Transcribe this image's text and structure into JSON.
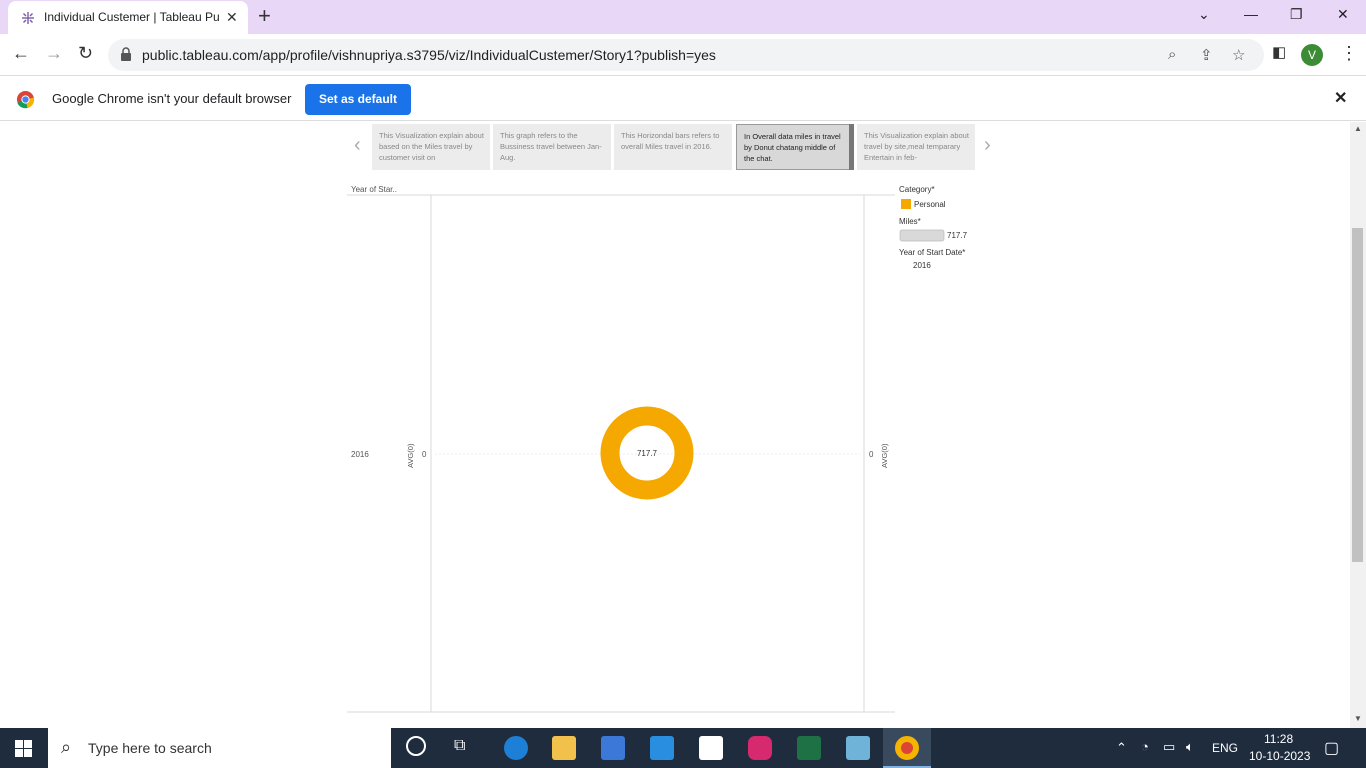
{
  "browser": {
    "tab_title": "Individual Custemer | Tableau Pu",
    "url": "public.tableau.com/app/profile/vishnupriya.s3795/viz/IndividualCustemer/Story1?publish=yes",
    "avatar_letter": "V"
  },
  "infobar": {
    "message": "Google Chrome isn't your default browser",
    "button_label": "Set as default"
  },
  "story": {
    "points": [
      {
        "text": "This Visualization explain about based on the Miles travel by customer visit  on"
      },
      {
        "text": "This graph refers to the Bussiness travel between Jan-Aug."
      },
      {
        "text": "This Horizondal bars refers to overall Miles travel in 2016."
      },
      {
        "text": "In Overall data miles in travel by Donut chatang middle of the chat."
      },
      {
        "text": "This Visualization explain about  travel by site,meal temparary Entertain in  feb-"
      }
    ]
  },
  "chart_data": {
    "type": "pie",
    "row_header": "Year of Star..",
    "row_label": "2016",
    "axis_label": "AVG(0)",
    "axis_tick_left": "0",
    "axis_tick_right": "0",
    "center_label": "717.7",
    "slices": [
      {
        "label": "Personal",
        "value": 717.7,
        "color": "#f5a800"
      }
    ],
    "legend": {
      "category_title": "Category*",
      "category_item": "Personal",
      "miles_title": "Miles*",
      "miles_value": "717.7",
      "year_title": "Year of Start Date*",
      "year_value": "2016"
    }
  },
  "taskbar": {
    "search_placeholder": "Type here to search",
    "lang": "ENG",
    "time": "11:28",
    "date": "10-10-2023"
  },
  "colors": {
    "donut": "#f5a800",
    "titlebar": "#e9d7f7",
    "accent": "#1a73e8",
    "taskbar": "#1f2c3d"
  }
}
